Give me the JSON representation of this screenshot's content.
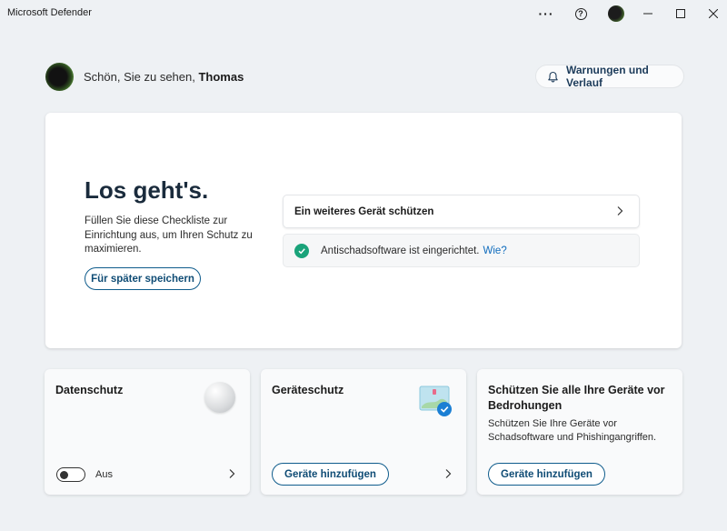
{
  "window": {
    "title": "Microsoft Defender",
    "more_glyph": "···",
    "help_glyph": "?"
  },
  "header": {
    "greeting_prefix": "Schön, Sie zu sehen,",
    "user_name": "Thomas",
    "alerts_button": "Warnungen und Verlauf"
  },
  "setup_card": {
    "title": "Los geht's.",
    "description": "Füllen Sie diese Checkliste zur Einrichtung aus, um Ihren Schutz zu maximieren.",
    "save_later": "Für später speichern",
    "checklist": [
      {
        "label": "Ein weiteres Gerät schützen",
        "done": false
      },
      {
        "label": "Antischadsoftware ist eingerichtet.",
        "link": "Wie?",
        "done": true
      }
    ]
  },
  "cards": {
    "privacy": {
      "title": "Datenschutz",
      "toggle_label": "Aus",
      "toggle_on": false
    },
    "device": {
      "title": "Geräteschutz",
      "button": "Geräte hinzufügen"
    },
    "protect_all": {
      "title": "Schützen Sie alle Ihre Geräte vor Bedrohungen",
      "description": "Schützen Sie Ihre Geräte vor Schadsoftware und Phishingangriffen.",
      "button": "Geräte hinzufügen"
    }
  },
  "colors": {
    "accent": "#0f5c8c",
    "success": "#1aa37a",
    "link": "#0f6cbd",
    "background": "#eef1f4"
  }
}
